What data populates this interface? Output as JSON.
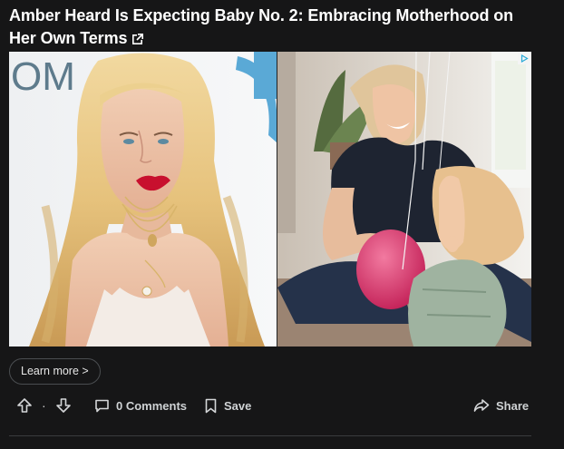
{
  "post": {
    "title": "Amber Heard Is Expecting Baby No. 2: Embracing Motherhood on Her Own Terms",
    "ext_icon": "external-link-icon"
  },
  "media": {
    "left_photo": "portrait-photo",
    "right_photo": "mother-and-baby-photo",
    "ad_icon": "ad-choices-icon"
  },
  "cta": {
    "learn_more_label": "Learn more >"
  },
  "actions": {
    "upvote_icon": "arrow-up-icon",
    "downvote_icon": "arrow-down-icon",
    "vote_separator": "·",
    "comments_label": "0 Comments",
    "save_label": "Save",
    "share_label": "Share"
  },
  "colors": {
    "background": "#161617",
    "text": "#ffffff",
    "muted": "#cfd2d4",
    "border": "#4a4d50"
  }
}
